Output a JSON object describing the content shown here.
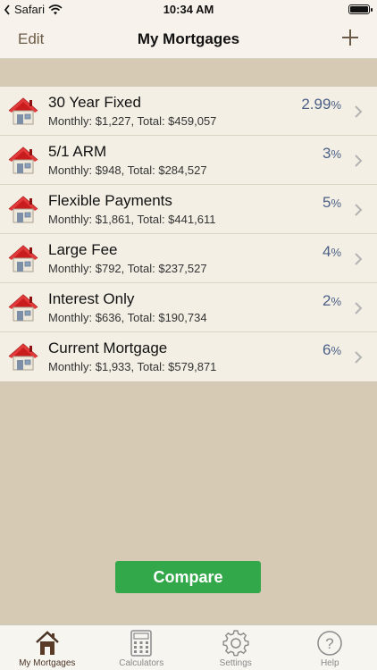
{
  "status_bar": {
    "back_app": "Safari",
    "time": "10:34 AM"
  },
  "nav": {
    "edit_label": "Edit",
    "title": "My Mortgages"
  },
  "mortgages": [
    {
      "name": "30 Year Fixed",
      "detail": "Monthly: $1,227, Total: $459,057",
      "rate": "2.99",
      "unit": "%"
    },
    {
      "name": "5/1 ARM",
      "detail": "Monthly: $948, Total: $284,527",
      "rate": "3",
      "unit": "%"
    },
    {
      "name": "Flexible Payments",
      "detail": "Monthly: $1,861, Total: $441,611",
      "rate": "5",
      "unit": "%"
    },
    {
      "name": "Large Fee",
      "detail": "Monthly: $792, Total: $237,527",
      "rate": "4",
      "unit": "%"
    },
    {
      "name": "Interest Only",
      "detail": "Monthly: $636, Total: $190,734",
      "rate": "2",
      "unit": "%"
    },
    {
      "name": "Current Mortgage",
      "detail": "Monthly: $1,933, Total: $579,871",
      "rate": "6",
      "unit": "%"
    }
  ],
  "compare_label": "Compare",
  "tabs": [
    {
      "label": "My Mortgages",
      "icon": "house-icon",
      "active": true
    },
    {
      "label": "Calculators",
      "icon": "calculator-icon",
      "active": false
    },
    {
      "label": "Settings",
      "icon": "gear-icon",
      "active": false
    },
    {
      "label": "Help",
      "icon": "question-icon",
      "active": false
    }
  ],
  "colors": {
    "accent_green": "#33a84b",
    "rate_blue": "#4b5f86",
    "house_roof": "#cc1f1f",
    "tab_active": "#4a3426"
  }
}
